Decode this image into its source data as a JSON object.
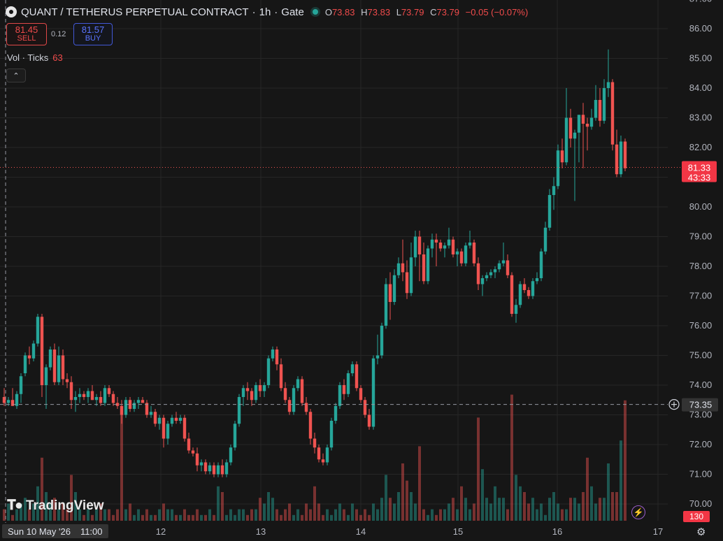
{
  "header": {
    "symbol": "QUANT / TETHERUS PERPETUAL CONTRACT",
    "interval": "1h",
    "exchange": "Gate",
    "separator": "·",
    "ohlc": {
      "o_label": "O",
      "o": "73.83",
      "h_label": "H",
      "h": "73.83",
      "l_label": "L",
      "l": "73.79",
      "c_label": "C",
      "c": "73.79",
      "change": "−0.05 (−0.07%)"
    }
  },
  "trade": {
    "sell_price": "81.45",
    "sell_label": "SELL",
    "spread": "0.12",
    "buy_price": "81.57",
    "buy_label": "BUY"
  },
  "volume": {
    "label": "Vol · Ticks",
    "value": "63"
  },
  "watermark": "TradingView",
  "crosshair": {
    "date_label": "Sun 10 May '26",
    "time_label": "11:00",
    "price_label": "73.35"
  },
  "last_price": {
    "price": "81.33",
    "countdown": "43:33"
  },
  "volume_label": "130",
  "colors": {
    "up": "#26a69a",
    "down": "#ef5350",
    "background": "#161616",
    "grid": "#262626"
  },
  "icons": {
    "collapse": "chevron-up-icon",
    "bolt": "lightning-icon",
    "settings": "gear-icon",
    "crosshair": "plus-circle-icon"
  },
  "chart_data": {
    "type": "candlestick",
    "y_axis": {
      "min": 70,
      "max": 87,
      "ticks": [
        "70.00",
        "71.00",
        "72.00",
        "73.00",
        "74.00",
        "75.00",
        "76.00",
        "77.00",
        "78.00",
        "79.00",
        "80.00",
        "81.00",
        "82.00",
        "83.00",
        "84.00",
        "85.00",
        "86.00",
        "87.00"
      ]
    },
    "x_axis": {
      "ticks": [
        "12",
        "13",
        "14",
        "15",
        "16",
        "17"
      ]
    },
    "grid": true,
    "candles": [
      [
        73.6,
        73.9,
        73.3,
        73.4
      ],
      [
        73.4,
        73.6,
        73.3,
        73.5
      ],
      [
        73.5,
        73.9,
        73.3,
        73.3
      ],
      [
        73.3,
        73.8,
        73.2,
        73.7
      ],
      [
        73.7,
        74.4,
        73.4,
        74.3
      ],
      [
        74.4,
        75.1,
        74.3,
        75.0
      ],
      [
        75.0,
        75.3,
        74.7,
        74.9
      ],
      [
        74.9,
        75.5,
        74.8,
        75.4
      ],
      [
        75.4,
        76.4,
        75.3,
        76.3
      ],
      [
        76.3,
        76.4,
        73.6,
        74.0
      ],
      [
        74.0,
        74.7,
        73.2,
        74.6
      ],
      [
        74.6,
        75.3,
        74.5,
        75.2
      ],
      [
        75.2,
        75.4,
        74.0,
        74.1
      ],
      [
        74.1,
        75.3,
        74.0,
        75.0
      ],
      [
        75.0,
        75.2,
        74.0,
        74.2
      ],
      [
        74.2,
        74.4,
        73.9,
        74.1
      ],
      [
        74.1,
        74.3,
        73.2,
        73.5
      ],
      [
        73.5,
        73.8,
        73.1,
        73.6
      ],
      [
        73.6,
        73.9,
        73.4,
        73.7
      ],
      [
        73.7,
        73.8,
        73.5,
        73.6
      ],
      [
        73.6,
        73.9,
        73.4,
        73.8
      ],
      [
        73.8,
        74.0,
        73.5,
        73.5
      ],
      [
        73.5,
        73.7,
        73.3,
        73.6
      ],
      [
        73.6,
        73.8,
        73.3,
        73.4
      ],
      [
        73.4,
        74.0,
        73.3,
        73.9
      ],
      [
        73.9,
        74.0,
        73.6,
        73.7
      ],
      [
        73.7,
        73.8,
        73.3,
        73.4
      ],
      [
        73.4,
        73.6,
        73.2,
        73.3
      ],
      [
        73.3,
        73.5,
        72.7,
        73.0
      ],
      [
        73.0,
        73.6,
        72.9,
        73.5
      ],
      [
        73.5,
        73.6,
        73.1,
        73.2
      ],
      [
        73.2,
        73.5,
        73.1,
        73.4
      ],
      [
        73.4,
        73.6,
        73.2,
        73.5
      ],
      [
        73.5,
        73.6,
        73.4,
        73.4
      ],
      [
        73.4,
        73.5,
        72.9,
        73.0
      ],
      [
        73.0,
        73.3,
        72.9,
        73.1
      ],
      [
        73.1,
        73.2,
        72.6,
        72.7
      ],
      [
        72.7,
        73.0,
        72.5,
        72.9
      ],
      [
        72.9,
        73.0,
        71.9,
        72.2
      ],
      [
        72.2,
        72.8,
        72.0,
        72.7
      ],
      [
        72.7,
        73.0,
        72.6,
        72.9
      ],
      [
        72.9,
        73.1,
        72.7,
        72.8
      ],
      [
        72.8,
        73.0,
        72.7,
        72.9
      ],
      [
        72.9,
        73.0,
        72.1,
        72.2
      ],
      [
        72.2,
        72.4,
        71.7,
        71.8
      ],
      [
        71.8,
        71.9,
        71.6,
        71.7
      ],
      [
        71.7,
        71.9,
        71.1,
        71.3
      ],
      [
        71.3,
        71.5,
        71.1,
        71.4
      ],
      [
        71.4,
        71.5,
        71.0,
        71.1
      ],
      [
        71.1,
        71.4,
        71.0,
        71.3
      ],
      [
        71.3,
        71.4,
        70.9,
        71.0
      ],
      [
        71.0,
        71.4,
        70.9,
        71.3
      ],
      [
        71.3,
        71.5,
        70.9,
        71.0
      ],
      [
        71.0,
        71.5,
        70.9,
        71.4
      ],
      [
        71.4,
        72.0,
        71.3,
        71.9
      ],
      [
        71.9,
        72.8,
        71.8,
        72.7
      ],
      [
        72.7,
        73.7,
        72.6,
        73.6
      ],
      [
        73.6,
        74.0,
        73.3,
        73.9
      ],
      [
        73.9,
        74.1,
        73.5,
        73.8
      ],
      [
        73.8,
        73.9,
        73.3,
        73.5
      ],
      [
        73.5,
        74.1,
        73.4,
        74.0
      ],
      [
        74.0,
        74.2,
        73.6,
        73.8
      ],
      [
        73.8,
        74.1,
        73.6,
        74.0
      ],
      [
        74.0,
        75.0,
        73.9,
        74.9
      ],
      [
        74.9,
        75.3,
        74.8,
        75.2
      ],
      [
        75.2,
        75.3,
        74.5,
        74.7
      ],
      [
        74.7,
        74.9,
        73.8,
        73.9
      ],
      [
        73.9,
        74.1,
        73.4,
        73.5
      ],
      [
        73.5,
        73.6,
        73.0,
        73.1
      ],
      [
        73.1,
        74.0,
        73.0,
        73.9
      ],
      [
        73.9,
        74.3,
        73.8,
        74.2
      ],
      [
        74.2,
        74.3,
        73.3,
        73.4
      ],
      [
        73.4,
        73.6,
        73.0,
        73.1
      ],
      [
        73.1,
        73.2,
        72.0,
        72.2
      ],
      [
        72.2,
        72.4,
        71.7,
        71.9
      ],
      [
        71.9,
        72.0,
        71.4,
        71.5
      ],
      [
        71.5,
        71.7,
        71.3,
        71.4
      ],
      [
        71.4,
        72.0,
        71.3,
        71.9
      ],
      [
        71.9,
        72.9,
        71.8,
        72.8
      ],
      [
        72.8,
        73.4,
        72.7,
        73.3
      ],
      [
        73.3,
        74.1,
        73.2,
        74.0
      ],
      [
        74.0,
        74.2,
        73.5,
        73.7
      ],
      [
        73.7,
        74.5,
        73.6,
        74.4
      ],
      [
        74.4,
        74.8,
        74.3,
        74.7
      ],
      [
        74.7,
        74.8,
        73.8,
        73.9
      ],
      [
        73.9,
        74.0,
        73.4,
        73.5
      ],
      [
        73.5,
        73.6,
        72.9,
        73.0
      ],
      [
        73.0,
        73.2,
        72.5,
        72.6
      ],
      [
        72.6,
        75.0,
        72.5,
        74.9
      ],
      [
        74.9,
        75.7,
        74.7,
        75.0
      ],
      [
        75.0,
        76.1,
        74.9,
        76.0
      ],
      [
        76.0,
        77.6,
        75.9,
        77.4
      ],
      [
        77.4,
        77.8,
        76.2,
        76.8
      ],
      [
        76.8,
        77.9,
        76.7,
        77.7
      ],
      [
        77.7,
        78.3,
        77.6,
        78.1
      ],
      [
        78.1,
        78.9,
        77.5,
        77.8
      ],
      [
        77.8,
        78.2,
        76.9,
        77.1
      ],
      [
        77.1,
        78.8,
        77.0,
        78.3
      ],
      [
        78.3,
        79.2,
        78.0,
        79.0
      ],
      [
        79.0,
        79.2,
        77.5,
        78.4
      ],
      [
        78.4,
        78.8,
        77.4,
        77.5
      ],
      [
        77.5,
        78.7,
        77.4,
        78.6
      ],
      [
        78.6,
        79.1,
        78.3,
        78.9
      ],
      [
        78.9,
        79.1,
        78.0,
        78.8
      ],
      [
        78.8,
        78.9,
        78.5,
        78.6
      ],
      [
        78.6,
        78.8,
        78.3,
        78.7
      ],
      [
        78.7,
        79.3,
        78.6,
        78.9
      ],
      [
        78.9,
        79.0,
        78.3,
        78.4
      ],
      [
        78.4,
        78.6,
        78.0,
        78.5
      ],
      [
        78.5,
        78.6,
        78.0,
        78.1
      ],
      [
        78.1,
        78.8,
        78.0,
        78.7
      ],
      [
        78.7,
        79.2,
        78.6,
        78.8
      ],
      [
        78.8,
        78.9,
        78.0,
        78.1
      ],
      [
        78.1,
        78.3,
        77.2,
        77.4
      ],
      [
        77.4,
        77.7,
        77.0,
        77.6
      ],
      [
        77.6,
        77.8,
        77.5,
        77.7
      ],
      [
        77.7,
        77.9,
        77.6,
        77.8
      ],
      [
        77.8,
        78.0,
        77.6,
        77.9
      ],
      [
        77.9,
        78.2,
        77.8,
        78.1
      ],
      [
        78.1,
        78.8,
        78.0,
        78.2
      ],
      [
        78.2,
        78.4,
        77.6,
        77.7
      ],
      [
        77.7,
        77.8,
        76.3,
        76.4
      ],
      [
        76.4,
        76.9,
        76.1,
        76.7
      ],
      [
        76.7,
        77.5,
        76.6,
        77.4
      ],
      [
        77.4,
        77.6,
        77.1,
        77.2
      ],
      [
        77.2,
        77.3,
        76.9,
        77.0
      ],
      [
        77.0,
        77.6,
        76.9,
        77.5
      ],
      [
        77.5,
        77.8,
        77.4,
        77.6
      ],
      [
        77.6,
        78.6,
        77.5,
        78.5
      ],
      [
        78.5,
        79.5,
        78.4,
        79.3
      ],
      [
        79.3,
        80.6,
        79.2,
        80.4
      ],
      [
        80.4,
        81.0,
        79.9,
        80.7
      ],
      [
        80.7,
        82.1,
        80.6,
        81.9
      ],
      [
        81.9,
        82.3,
        81.3,
        81.5
      ],
      [
        81.5,
        84.0,
        81.4,
        83.0
      ],
      [
        83.0,
        83.3,
        82.0,
        82.3
      ],
      [
        82.3,
        82.6,
        80.2,
        82.5
      ],
      [
        82.5,
        83.0,
        81.5,
        83.1
      ],
      [
        83.1,
        83.5,
        81.3,
        82.8
      ],
      [
        82.8,
        83.0,
        81.9,
        82.7
      ],
      [
        82.7,
        83.3,
        82.6,
        83.0
      ],
      [
        83.0,
        84.1,
        82.9,
        83.6
      ],
      [
        83.6,
        84.0,
        82.7,
        82.9
      ],
      [
        82.9,
        84.3,
        82.8,
        84.0
      ],
      [
        84.0,
        85.3,
        83.7,
        84.2
      ],
      [
        84.2,
        84.3,
        81.9,
        82.1
      ],
      [
        82.1,
        82.6,
        81.0,
        81.1
      ],
      [
        81.1,
        82.4,
        81.0,
        82.2
      ],
      [
        82.2,
        82.3,
        81.2,
        81.3
      ]
    ],
    "volumes": [
      2,
      3,
      1,
      2,
      3,
      4,
      2,
      3,
      6,
      11,
      5,
      3,
      4,
      2,
      3,
      2,
      8,
      5,
      2,
      1,
      2,
      1,
      2,
      3,
      2,
      2,
      1,
      2,
      20,
      2,
      3,
      1,
      2,
      1,
      2,
      1,
      1,
      2,
      3,
      2,
      2,
      1,
      1,
      2,
      1,
      1,
      2,
      1,
      1,
      2,
      1,
      6,
      5,
      1,
      2,
      1,
      2,
      2,
      1,
      2,
      2,
      4,
      3,
      5,
      4,
      2,
      1,
      2,
      3,
      1,
      2,
      1,
      3,
      2,
      6,
      3,
      1,
      2,
      1,
      2,
      3,
      2,
      1,
      3,
      2,
      1,
      2,
      1,
      3,
      2,
      4,
      8,
      4,
      3,
      5,
      10,
      7,
      5,
      3,
      13,
      2,
      1,
      2,
      1,
      2,
      2,
      3,
      4,
      2,
      6,
      4,
      2,
      3,
      18,
      9,
      4,
      3,
      6,
      4,
      4,
      2,
      22,
      8,
      6,
      5,
      3,
      4,
      2,
      3,
      1,
      4,
      5,
      3,
      2,
      2,
      4,
      4,
      3,
      5,
      11,
      6,
      3,
      4,
      4,
      10,
      5,
      5,
      14,
      21,
      4,
      3
    ]
  }
}
